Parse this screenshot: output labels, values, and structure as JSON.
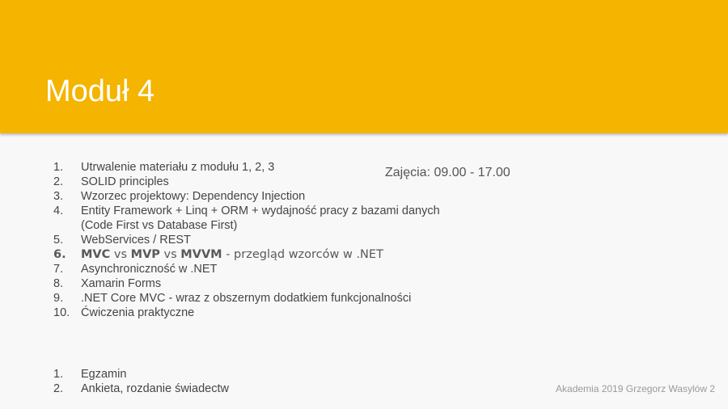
{
  "slide": {
    "title": "Moduł 4",
    "hours": "Zajęcia: 09.00 - 17.00",
    "footer": "Akademia 2019 Grzegorz Wasylów 2"
  },
  "topics": [
    {
      "num": "1.",
      "text": "Utrwalenie materiału z modułu 1, 2, 3"
    },
    {
      "num": "2.",
      "text": "SOLID principles"
    },
    {
      "num": "3.",
      "text": "Wzorzec projektowy: Dependency Injection"
    },
    {
      "num": "4.",
      "text": "Entity Framework + Linq + ORM + wydajność pracy z bazami danych"
    },
    {
      "num": "",
      "text": "(Code First vs Database First)"
    },
    {
      "num": "5.",
      "text": "WebServices / REST"
    },
    {
      "num": "6.",
      "mvc": "MVC",
      "vs1": " vs ",
      "mvp": "MVP",
      "vs2": " vs ",
      "mvvm": "MVVM",
      "rest": " - przegląd wzorców w .NET"
    },
    {
      "num": "7.",
      "text": "Asynchroniczność w .NET"
    },
    {
      "num": "8.",
      "text": "Xamarin Forms"
    },
    {
      "num": "9.",
      "text": ".NET Core MVC - wraz z obszernym dodatkiem funkcjonalności"
    },
    {
      "num": "10.",
      "text": "Ćwiczenia praktyczne"
    }
  ],
  "final_items": [
    {
      "num": "1.",
      "text": "Egzamin"
    },
    {
      "num": "2.",
      "text": "Ankieta, rozdanie świadectw"
    }
  ]
}
